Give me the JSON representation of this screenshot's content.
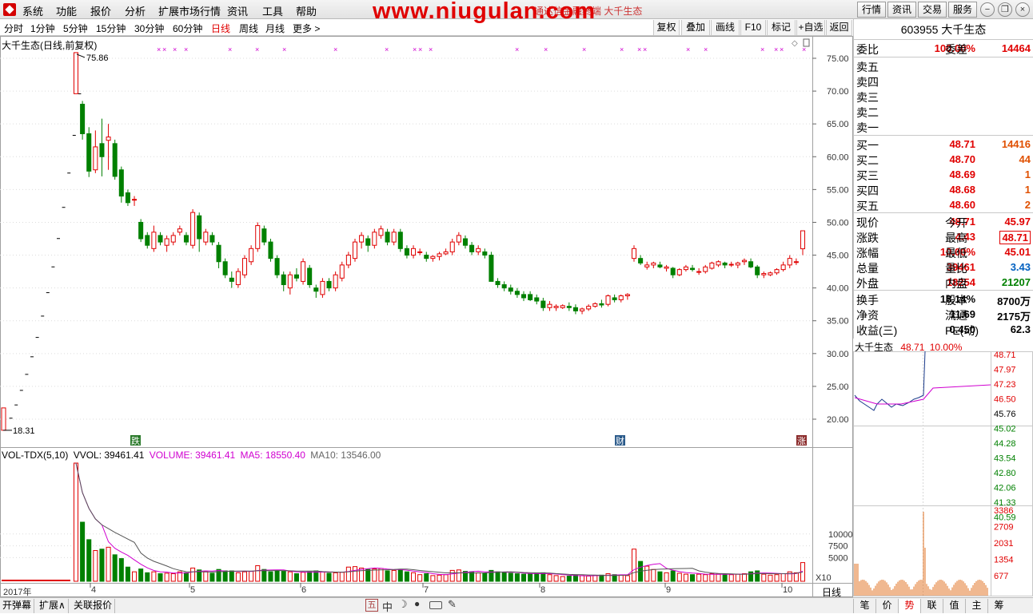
{
  "menu": [
    "系统",
    "功能",
    "报价",
    "分析",
    "扩展市场行情",
    "资讯",
    "工具",
    "帮助"
  ],
  "watermark": "www.niugulan.com",
  "title_small": "通达信金融终端  大千生态",
  "top_right_buttons": [
    "行情",
    "资讯",
    "交易",
    "服务"
  ],
  "periods": [
    "分时",
    "1分钟",
    "5分钟",
    "15分钟",
    "30分钟",
    "60分钟",
    "日线",
    "周线",
    "月线",
    "更多 >"
  ],
  "active_period": "日线",
  "tools": [
    "复权",
    "叠加",
    "画线",
    "F10",
    "标记",
    "+自选",
    "返回"
  ],
  "chart": {
    "title": "大千生态(日线,前复权)",
    "high_label": "75.86",
    "low_label": "18.31",
    "badges": [
      "跌",
      "财",
      "涨"
    ]
  },
  "vol_title": {
    "name": "VOL-TDX(5,10)",
    "vvol": "VVOL: 39461.41",
    "volume": "VOLUME: 39461.41",
    "ma5": "MA5: 18550.40",
    "ma10": "MA10: 13546.00"
  },
  "x_labels": [
    "2017年",
    "4",
    "5",
    "6",
    "7",
    "8",
    "9",
    "10"
  ],
  "x_corner": "日线",
  "vol_scale": "X10",
  "quote": {
    "code_name": "603955 大千生态",
    "weibi_label": "委比",
    "weibi_val": "100.00%",
    "weicha_label": "委差",
    "weicha_val": "14464",
    "sells": [
      "卖五",
      "卖四",
      "卖三",
      "卖二",
      "卖一"
    ],
    "buys": [
      {
        "label": "买一",
        "price": "48.71",
        "vol": "14416"
      },
      {
        "label": "买二",
        "price": "48.70",
        "vol": "44"
      },
      {
        "label": "买三",
        "price": "48.69",
        "vol": "1"
      },
      {
        "label": "买四",
        "price": "48.68",
        "vol": "1"
      },
      {
        "label": "买五",
        "price": "48.60",
        "vol": "2"
      }
    ],
    "stats": [
      {
        "l": "现价",
        "v": "48.71",
        "vc": "red",
        "l2": "今开",
        "v2": "45.97",
        "v2c": "red"
      },
      {
        "l": "涨跌",
        "v": "4.43",
        "vc": "red",
        "l2": "最高",
        "v2": "48.71",
        "v2c": "red"
      },
      {
        "l": "涨幅",
        "v": "10.00%",
        "vc": "red",
        "l2": "最低",
        "v2": "45.01",
        "v2c": "red"
      },
      {
        "l": "总量",
        "v": "39461",
        "vc": "red",
        "l2": "量比",
        "v2": "3.43",
        "v2c": "blue"
      },
      {
        "l": "外盘",
        "v": "18254",
        "vc": "red",
        "l2": "内盘",
        "v2": "21207",
        "v2c": "green"
      }
    ],
    "stats2": [
      {
        "l": "换手",
        "v": "18.14%",
        "l2": "股本",
        "v2": "8700万"
      },
      {
        "l": "净资",
        "v": "11.69",
        "l2": "流通",
        "v2": "2175万"
      },
      {
        "l": "收益(三)",
        "v": "0.450",
        "l2": "PE(动)",
        "v2": "62.3"
      }
    ]
  },
  "mini": {
    "name": "大千生态",
    "price": "48.71",
    "pct": "10.00%",
    "price_ticks": [
      "48.71",
      "47.97",
      "47.23",
      "46.50",
      "45.76",
      "45.02",
      "44.28",
      "43.54",
      "42.80",
      "42.06",
      "41.33",
      "40.59"
    ],
    "vol_ticks": [
      "3386",
      "2709",
      "2031",
      "1354",
      "677"
    ]
  },
  "bottom_left": [
    "开弹幕",
    "扩展∧",
    "关联报价"
  ],
  "bottom_icons": [
    "五",
    "中",
    "moon",
    "drop",
    "keyboard",
    "wrench"
  ],
  "bottom_right": [
    "笔",
    "价",
    "势",
    "联",
    "值",
    "主",
    "筹"
  ],
  "bottom_active": "势",
  "chart_data": {
    "type": "candlestick",
    "title": "大千生态(日线,前复权)",
    "y_ticks": [
      75.0,
      70.0,
      65.0,
      60.0,
      55.0,
      50.0,
      45.0,
      40.0,
      35.0,
      30.0,
      25.0,
      20.0
    ],
    "ylim": [
      18,
      77
    ],
    "vol_ticks": [
      10000,
      7500,
      5000
    ],
    "ipo_steps": [
      18.31,
      20.15,
      22.17,
      24.39,
      26.83,
      29.51,
      32.46,
      35.71,
      39.28,
      43.21,
      47.53,
      52.28,
      57.51,
      63.26,
      69.59
    ],
    "candles": [
      [
        69.6,
        75.86,
        69.6,
        75.86,
        2500
      ],
      [
        68.0,
        68.5,
        62.6,
        63.5,
        1250
      ],
      [
        63.5,
        64.5,
        56.9,
        57.8,
        880
      ],
      [
        58.0,
        64.0,
        57.5,
        61.5,
        650
      ],
      [
        62.0,
        65.8,
        57.0,
        60.0,
        680
      ],
      [
        62.5,
        65.0,
        58.0,
        63.0,
        720
      ],
      [
        62.0,
        62.6,
        56.5,
        57.0,
        560
      ],
      [
        58.0,
        58.5,
        53.0,
        54.0,
        480
      ],
      [
        54.5,
        55.0,
        52.5,
        53.0,
        300
      ],
      [
        53.5,
        54.0,
        52.5,
        53.5,
        200
      ],
      [
        50.0,
        50.5,
        47.0,
        47.5,
        260
      ],
      [
        48.0,
        48.5,
        46.0,
        46.5,
        180
      ],
      [
        46.0,
        49.5,
        45.5,
        48.5,
        200
      ],
      [
        48.0,
        48.5,
        46.5,
        47.0,
        160
      ],
      [
        46.5,
        48.0,
        45.5,
        47.5,
        170
      ],
      [
        47.0,
        48.5,
        46.5,
        48.0,
        160
      ],
      [
        48.5,
        49.5,
        48.0,
        49.0,
        200
      ],
      [
        48.0,
        48.5,
        46.5,
        47.0,
        180
      ],
      [
        46.5,
        52.0,
        46.0,
        51.5,
        280
      ],
      [
        51.0,
        51.5,
        45.5,
        47.5,
        240
      ],
      [
        47.0,
        49.0,
        46.5,
        48.5,
        200
      ],
      [
        48.0,
        48.5,
        46.5,
        47.0,
        170
      ],
      [
        46.5,
        47.0,
        43.0,
        44.0,
        250
      ],
      [
        44.0,
        44.5,
        41.5,
        42.0,
        220
      ],
      [
        41.5,
        42.5,
        40.0,
        41.0,
        220
      ],
      [
        40.5,
        43.0,
        40.0,
        42.5,
        180
      ],
      [
        42.0,
        45.0,
        41.5,
        44.5,
        200
      ],
      [
        44.0,
        46.5,
        43.5,
        46.0,
        210
      ],
      [
        46.0,
        50.0,
        45.5,
        49.5,
        330
      ],
      [
        49.0,
        49.5,
        46.5,
        47.0,
        250
      ],
      [
        47.0,
        47.5,
        44.0,
        44.5,
        200
      ],
      [
        44.5,
        45.0,
        41.5,
        42.0,
        220
      ],
      [
        42.0,
        42.5,
        39.5,
        40.5,
        210
      ],
      [
        40.0,
        42.5,
        39.0,
        42.0,
        200
      ],
      [
        42.0,
        43.0,
        41.0,
        41.5,
        160
      ],
      [
        41.0,
        44.5,
        40.5,
        44.0,
        190
      ],
      [
        43.0,
        43.5,
        40.0,
        40.5,
        200
      ],
      [
        40.0,
        40.5,
        38.5,
        39.5,
        220
      ],
      [
        39.0,
        41.5,
        38.5,
        41.0,
        200
      ],
      [
        41.0,
        41.5,
        39.5,
        40.0,
        170
      ],
      [
        40.0,
        42.5,
        39.5,
        42.0,
        180
      ],
      [
        41.5,
        44.0,
        41.0,
        43.5,
        190
      ],
      [
        43.5,
        45.5,
        43.0,
        45.0,
        300
      ],
      [
        44.5,
        47.5,
        44.0,
        47.0,
        310
      ],
      [
        47.0,
        48.5,
        46.0,
        48.0,
        280
      ],
      [
        47.5,
        48.0,
        45.5,
        46.5,
        250
      ],
      [
        46.5,
        49.0,
        46.0,
        48.5,
        260
      ],
      [
        48.0,
        49.5,
        47.5,
        49.0,
        270
      ],
      [
        48.5,
        49.0,
        46.5,
        47.0,
        220
      ],
      [
        47.0,
        49.0,
        46.5,
        48.5,
        230
      ],
      [
        48.5,
        49.0,
        45.5,
        46.0,
        250
      ],
      [
        46.0,
        46.5,
        44.5,
        45.0,
        200
      ],
      [
        45.0,
        46.5,
        44.5,
        46.0,
        180
      ],
      [
        45.5,
        46.0,
        45.0,
        45.5,
        140
      ],
      [
        45.0,
        45.5,
        44.0,
        44.5,
        160
      ],
      [
        44.5,
        45.0,
        44.0,
        44.8,
        120
      ],
      [
        44.8,
        45.5,
        44.2,
        45.2,
        130
      ],
      [
        45.2,
        46.0,
        45.0,
        45.5,
        140
      ],
      [
        45.5,
        47.5,
        45.0,
        47.0,
        230
      ],
      [
        47.0,
        48.5,
        46.5,
        48.0,
        240
      ],
      [
        47.5,
        48.0,
        46.0,
        46.5,
        210
      ],
      [
        46.5,
        47.0,
        45.0,
        45.5,
        200
      ],
      [
        45.5,
        46.5,
        45.0,
        46.0,
        180
      ],
      [
        45.5,
        46.0,
        44.5,
        45.0,
        170
      ],
      [
        45.0,
        45.5,
        41.5,
        41.0,
        230
      ],
      [
        41.0,
        41.5,
        40.0,
        40.5,
        200
      ],
      [
        40.5,
        41.0,
        39.5,
        40.0,
        180
      ],
      [
        40.0,
        40.5,
        39.0,
        39.5,
        170
      ],
      [
        39.5,
        40.0,
        38.5,
        39.0,
        160
      ],
      [
        39.0,
        39.5,
        38.0,
        38.5,
        150
      ],
      [
        39.0,
        39.5,
        38.0,
        38.2,
        160
      ],
      [
        38.5,
        39.0,
        37.5,
        38.0,
        170
      ],
      [
        38.0,
        38.5,
        36.5,
        37.0,
        180
      ],
      [
        37.0,
        38.0,
        36.5,
        37.5,
        140
      ],
      [
        37.0,
        37.5,
        36.5,
        37.2,
        120
      ],
      [
        37.0,
        37.5,
        36.8,
        37.3,
        100
      ],
      [
        37.2,
        37.8,
        36.5,
        37.0,
        110
      ],
      [
        37.0,
        37.5,
        36.0,
        36.5,
        130
      ],
      [
        36.5,
        37.0,
        36.0,
        36.8,
        120
      ],
      [
        36.8,
        37.5,
        36.5,
        37.2,
        110
      ],
      [
        37.2,
        37.8,
        37.0,
        37.6,
        120
      ],
      [
        37.6,
        38.2,
        37.0,
        37.4,
        130
      ],
      [
        37.5,
        39.0,
        37.2,
        38.8,
        160
      ],
      [
        38.5,
        39.0,
        37.8,
        38.2,
        140
      ],
      [
        38.2,
        39.0,
        37.8,
        38.8,
        130
      ],
      [
        38.8,
        39.2,
        38.2,
        39.0,
        120
      ],
      [
        44.5,
        46.5,
        44.0,
        46.0,
        680
      ],
      [
        44.5,
        45.0,
        43.5,
        43.8,
        420
      ],
      [
        43.2,
        44.0,
        42.8,
        43.5,
        320
      ],
      [
        43.5,
        44.0,
        43.0,
        43.8,
        250
      ],
      [
        43.5,
        44.0,
        43.0,
        43.2,
        200
      ],
      [
        43.0,
        43.5,
        42.5,
        43.2,
        180
      ],
      [
        43.0,
        43.2,
        41.5,
        42.0,
        220
      ],
      [
        42.0,
        43.0,
        41.8,
        42.8,
        170
      ],
      [
        42.8,
        43.5,
        42.5,
        43.2,
        150
      ],
      [
        43.0,
        43.5,
        42.5,
        42.8,
        140
      ],
      [
        42.5,
        43.0,
        42.0,
        42.5,
        150
      ],
      [
        42.5,
        43.5,
        42.2,
        43.2,
        140
      ],
      [
        43.0,
        44.0,
        42.8,
        43.8,
        160
      ],
      [
        43.5,
        44.2,
        43.2,
        44.0,
        150
      ],
      [
        43.8,
        44.0,
        43.0,
        43.5,
        150
      ],
      [
        43.5,
        44.0,
        43.2,
        43.6,
        140
      ],
      [
        43.5,
        44.0,
        43.0,
        43.8,
        150
      ],
      [
        44.0,
        44.5,
        43.5,
        44.2,
        160
      ],
      [
        44.0,
        44.5,
        43.0,
        43.2,
        200
      ],
      [
        43.2,
        43.5,
        41.5,
        42.0,
        220
      ],
      [
        42.0,
        42.5,
        41.5,
        42.2,
        150
      ],
      [
        42.0,
        42.5,
        41.8,
        42.3,
        130
      ],
      [
        42.3,
        43.0,
        42.0,
        42.8,
        140
      ],
      [
        42.8,
        44.0,
        42.5,
        43.5,
        160
      ],
      [
        43.5,
        45.0,
        43.0,
        44.5,
        200
      ],
      [
        44.0,
        44.5,
        43.5,
        44.0,
        180
      ],
      [
        45.97,
        48.71,
        45.01,
        48.71,
        395
      ]
    ]
  }
}
